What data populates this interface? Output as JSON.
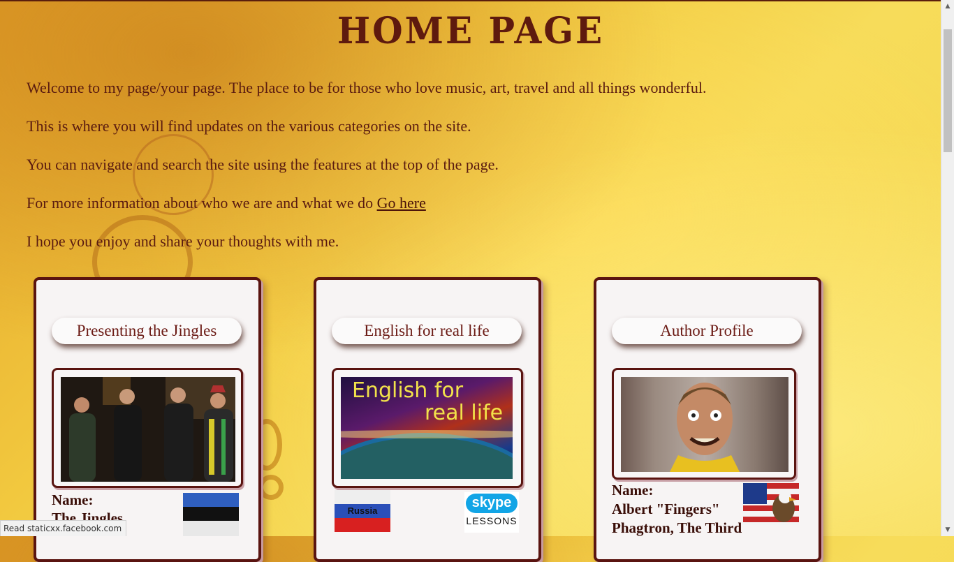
{
  "page": {
    "title": "HOME PAGE",
    "intro": [
      "Welcome to my page/your page. The place to be for those who love music, art, travel and all things wonderful.",
      "This is where you will find updates on the various categories on the site.",
      "You can navigate and search the site using the features at the top of the page.",
      "For more information about who we are and what we do ",
      "I hope you enjoy and share your thoughts with me."
    ],
    "go_here_link": "Go here"
  },
  "cards": [
    {
      "title": "Presenting the Jingles",
      "name_label": "Name:",
      "name_value": "The Jingles",
      "flag": "estonia-flag"
    },
    {
      "title": "English for real life",
      "banner_line1": "English for",
      "banner_line2": "real life",
      "russia_label": "Russia",
      "skype_label": "skype",
      "lessons_label": "LESSONS"
    },
    {
      "title": "Author Profile",
      "name_label": "Name:",
      "name_value_line1": "Albert \"Fingers\"",
      "name_value_line2": "Phagtron, The Third",
      "flag": "usa-flag-eagle"
    }
  ],
  "status_bar": {
    "text": "Read staticxx.facebook.com"
  },
  "colors": {
    "title": "#5e1a0e",
    "text": "#5a1b10",
    "card_border": "#5a1410",
    "card_bg": "#f7f4f4"
  }
}
